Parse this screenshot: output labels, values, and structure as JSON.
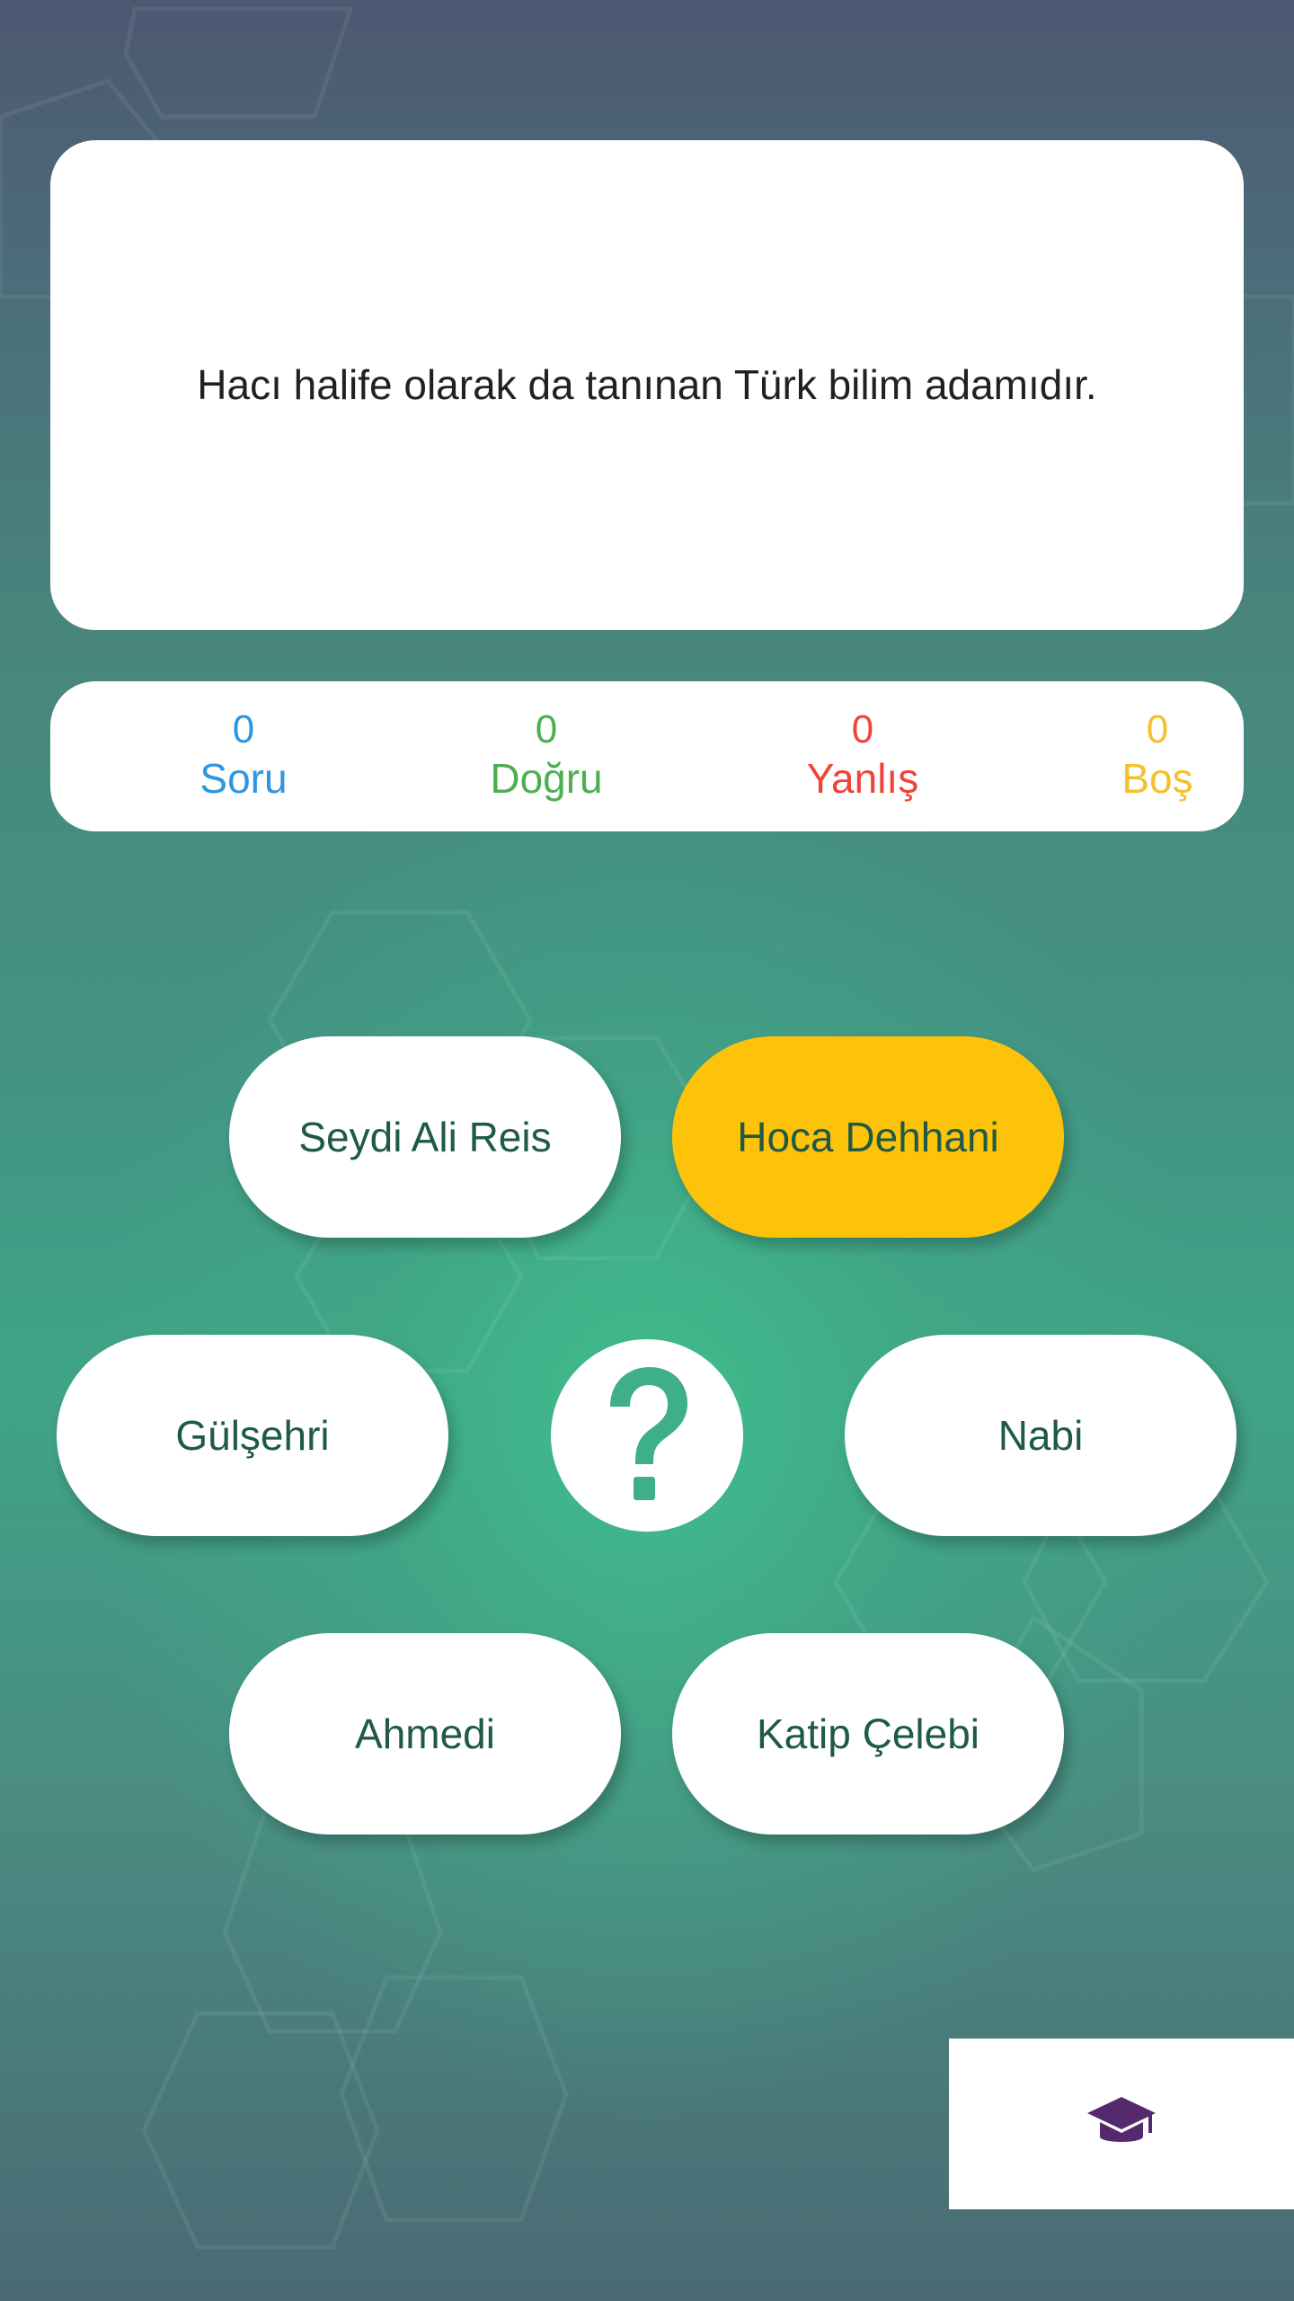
{
  "question": {
    "text": "Hacı halife olarak da tanınan Türk bilim adamıdır."
  },
  "stats": {
    "soru": {
      "value": "0",
      "label": "Soru",
      "color": "#2f96e0"
    },
    "dogru": {
      "value": "0",
      "label": "Doğru",
      "color": "#4caf50"
    },
    "yanlis": {
      "value": "0",
      "label": "Yanlış",
      "color": "#f04438"
    },
    "bos": {
      "value": "0",
      "label": "Boş",
      "color": "#f4c02e"
    }
  },
  "options": [
    {
      "label": "Seydi Ali Reis",
      "selected": false
    },
    {
      "label": "Hoca Dehhani",
      "selected": true
    },
    {
      "label": "Gülşehri",
      "selected": false
    },
    {
      "label": "Nabi",
      "selected": false
    },
    {
      "label": "Ahmedi",
      "selected": false
    },
    {
      "label": "Katip Çelebi",
      "selected": false
    }
  ],
  "help_button": {
    "icon": "question-mark-icon",
    "color": "#3fae8a"
  },
  "corner_button": {
    "icon": "graduation-cap-icon",
    "color": "#55296e"
  },
  "colors": {
    "selected_option": "#fdc20a",
    "option_text": "#1f5a45"
  }
}
